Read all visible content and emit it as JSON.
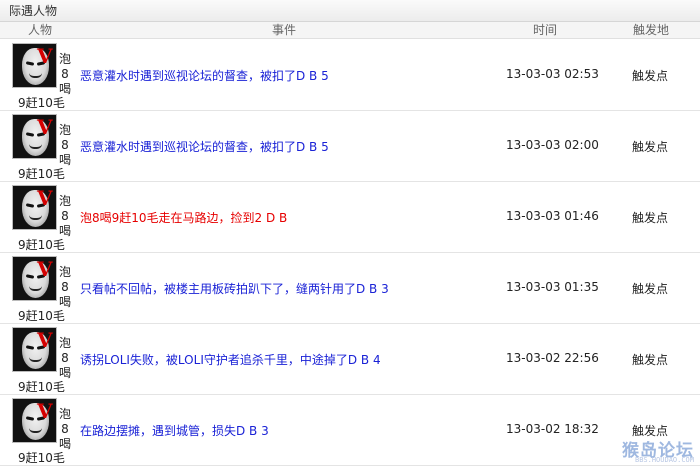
{
  "panel": {
    "title": "际遇人物"
  },
  "columns": {
    "person": "人物",
    "event": "事件",
    "time": "时间",
    "where": "触发地"
  },
  "rows": [
    {
      "name_side": "泡 8 喝",
      "name_bottom": "9赶10毛",
      "event": "恶意灌水时遇到巡视论坛的督查，被扣了D B 5",
      "event_color": "#1a22d6",
      "time": "13-03-03 02:53",
      "where": "触发点"
    },
    {
      "name_side": "泡 8 喝",
      "name_bottom": "9赶10毛",
      "event": "恶意灌水时遇到巡视论坛的督查，被扣了D B 5",
      "event_color": "#1a22d6",
      "time": "13-03-03 02:00",
      "where": "触发点"
    },
    {
      "name_side": "泡 8 喝",
      "name_bottom": "9赶10毛",
      "event": "泡8喝9赶10毛走在马路边，捡到2 D B",
      "event_color": "#e60000",
      "time": "13-03-03 01:46",
      "where": "触发点"
    },
    {
      "name_side": "泡 8 喝",
      "name_bottom": "9赶10毛",
      "event": "只看帖不回帖，被楼主用板砖拍趴下了，缝两针用了D B 3",
      "event_color": "#1a22d6",
      "time": "13-03-03 01:35",
      "where": "触发点"
    },
    {
      "name_side": "泡 8 喝",
      "name_bottom": "9赶10毛",
      "event": "诱拐LOLI失败，被LOLI守护者追杀千里，中途掉了D B 4",
      "event_color": "#1a22d6",
      "time": "13-03-02 22:56",
      "where": "触发点"
    },
    {
      "name_side": "泡 8 喝",
      "name_bottom": "9赶10毛",
      "event": "在路边摆摊，遇到城管，损失D B 3",
      "event_color": "#1a22d6",
      "time": "13-03-02 18:32",
      "where": "触发点"
    }
  ],
  "watermark": {
    "main": "猴岛论坛",
    "sub": "BBS.HOUDAO.COM"
  },
  "icons": {
    "avatar": "v-mask-avatar-icon"
  }
}
